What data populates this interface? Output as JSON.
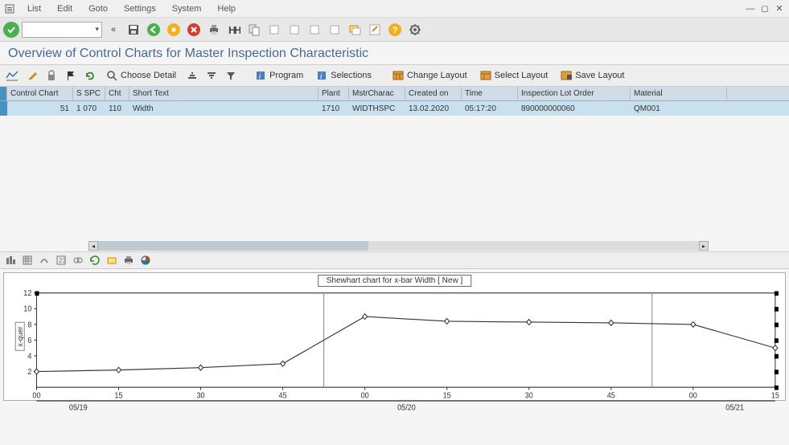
{
  "menus": [
    "List",
    "Edit",
    "Goto",
    "Settings",
    "System",
    "Help"
  ],
  "page_title": "Overview of Control Charts for Master Inspection Characteristic",
  "toolbar2": {
    "choose_detail": "Choose Detail",
    "program": "Program",
    "selections": "Selections",
    "change_layout": "Change Layout",
    "select_layout": "Select Layout",
    "save_layout": "Save Layout"
  },
  "table": {
    "headers": {
      "control_chart": "Control Chart",
      "sspc": "S SPC",
      "cht": "Cht",
      "short_text": "Short Text",
      "plant": "Plant",
      "mstrcharac": "MstrCharac",
      "created_on": "Created on",
      "time": "Time",
      "inspection_lot_order": "Inspection Lot Order",
      "material": "Material"
    },
    "row": {
      "control_chart": "51",
      "sspc": "1 070",
      "cht": "110",
      "short_text": "Width",
      "plant": "1710",
      "mstrcharac": "WIDTHSPC",
      "created_on": "13.02.2020",
      "time": "05:17:20",
      "inspection_lot_order": "890000000060",
      "material": "QM001"
    }
  },
  "chart_title": "Shewhart chart for x-bar Width [ New ]",
  "chart_ylabel": "x-quer",
  "chart_data": {
    "type": "line",
    "ylim": [
      0,
      12
    ],
    "yticks": [
      2,
      4,
      6,
      8,
      10,
      12
    ],
    "x_time_labels": [
      "00",
      "15",
      "30",
      "45",
      "00",
      "15",
      "30",
      "45",
      "00",
      "15"
    ],
    "x_date_labels": {
      "05/19": 0,
      "05/20": 4,
      "05/21": 8
    },
    "series": [
      {
        "name": "x-bar",
        "values": [
          2.0,
          2.2,
          2.5,
          3.0,
          9.0,
          8.4,
          8.3,
          8.2,
          8.0,
          5.0
        ]
      }
    ]
  }
}
